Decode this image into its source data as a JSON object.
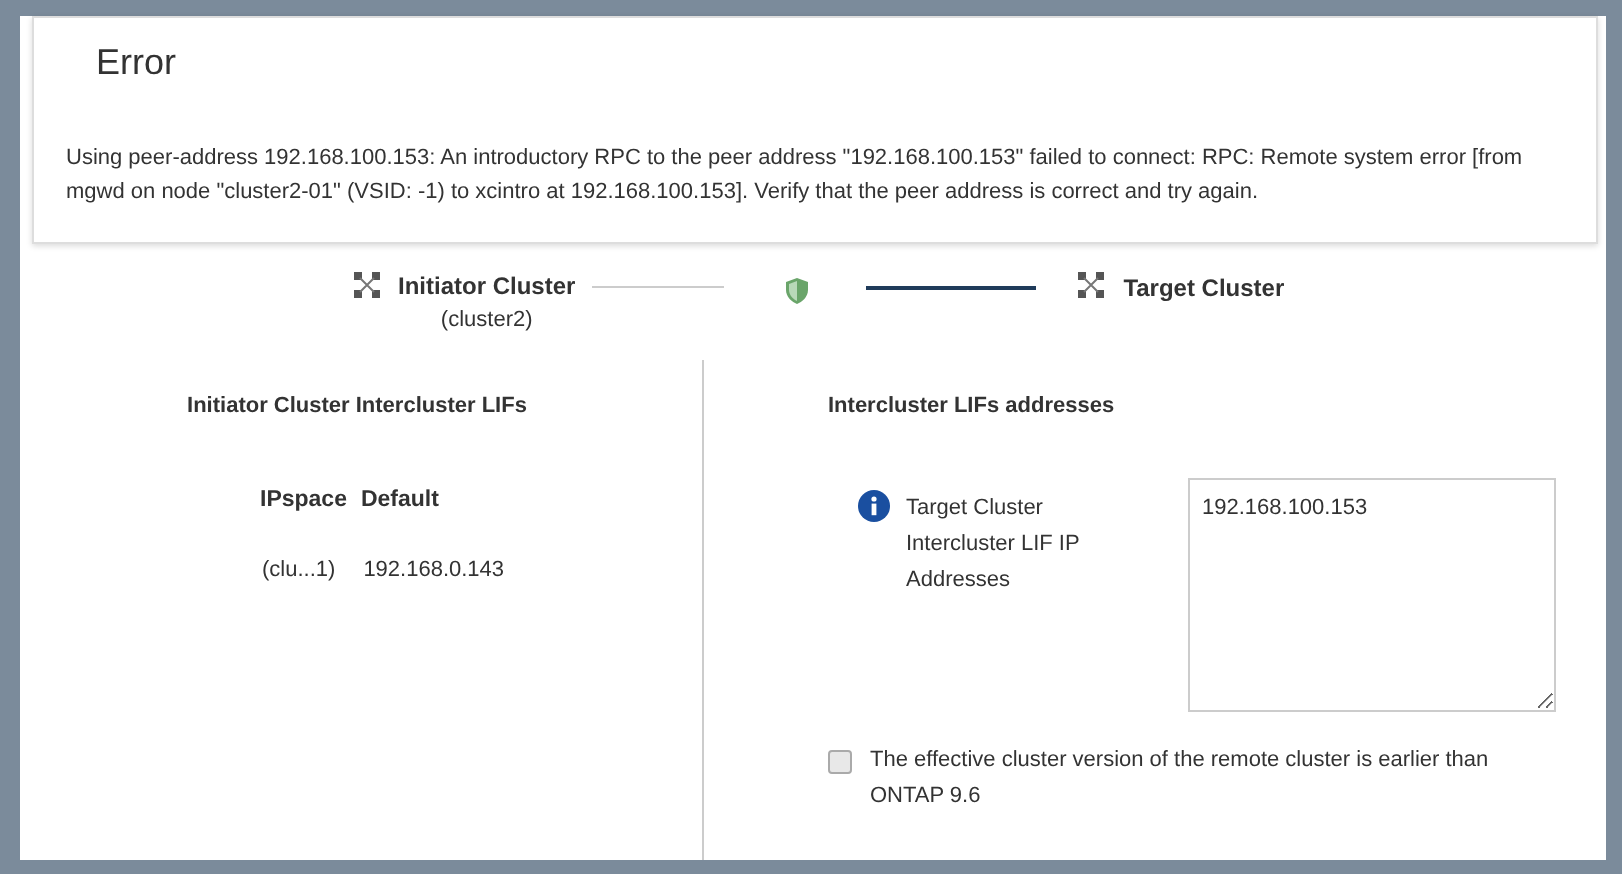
{
  "error": {
    "title": "Error",
    "message": "Using peer-address 192.168.100.153: An introductory RPC to the peer address \"192.168.100.153\" failed to connect: RPC: Remote system error [from mgwd on node \"cluster2-01\" (VSID: -1) to xcintro at 192.168.100.153]. Verify that the peer address is correct and try again."
  },
  "clusters": {
    "initiator": {
      "name": "Initiator Cluster",
      "subtitle": "(cluster2)"
    },
    "target": {
      "name": "Target Cluster"
    }
  },
  "left_panel": {
    "heading": "Initiator Cluster Intercluster LIFs",
    "ipspace_label": "IPspace",
    "ipspace_value": "Default",
    "lifs": [
      {
        "node": "(clu...1)",
        "address": "192.168.0.143"
      }
    ]
  },
  "right_panel": {
    "heading": "Intercluster LIFs addresses",
    "field_label": "Target Cluster Intercluster LIF IP Addresses",
    "field_value": "192.168.100.153",
    "checkbox": {
      "label": "The effective cluster version of the remote cluster is earlier than ONTAP 9.6",
      "checked": false
    }
  }
}
